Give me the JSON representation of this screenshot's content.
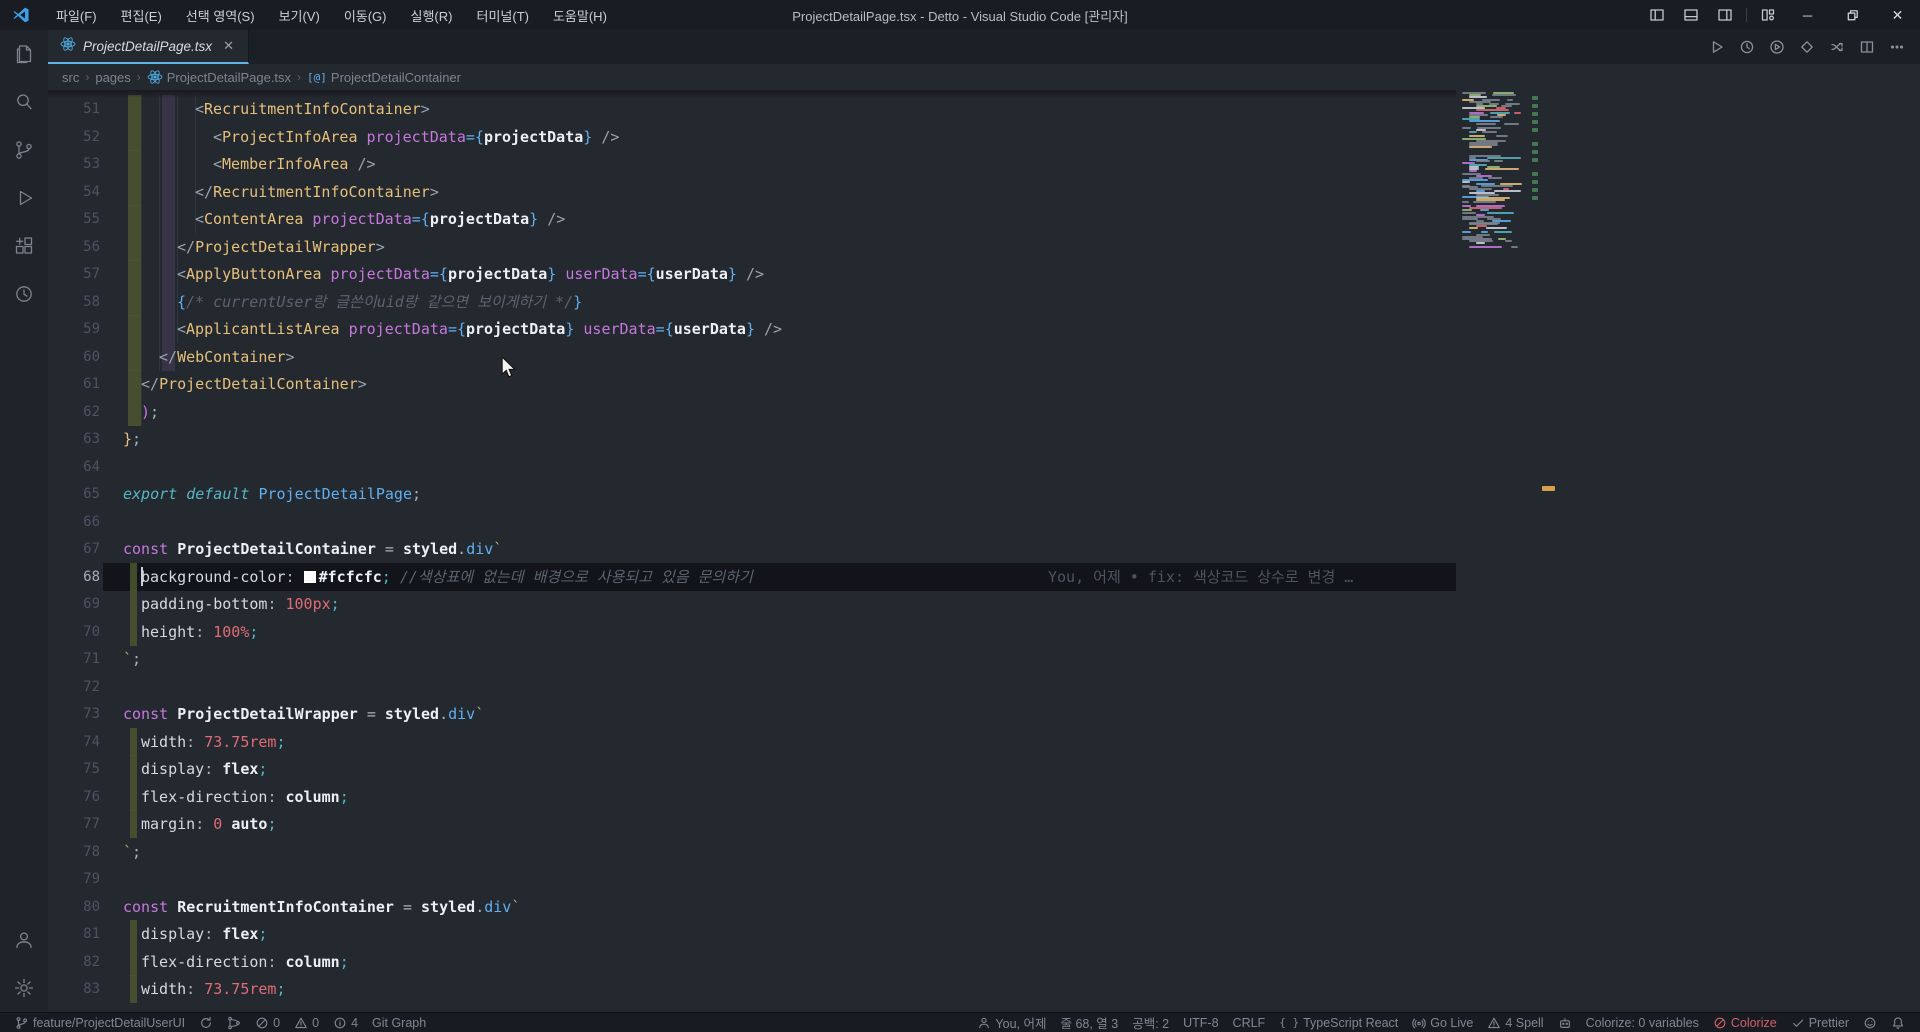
{
  "titlebar": {
    "title": "ProjectDetailPage.tsx - Detto - Visual Studio Code [관리자]",
    "menus": [
      "파일(F)",
      "편집(E)",
      "선택 영역(S)",
      "보기(V)",
      "이동(G)",
      "실행(R)",
      "터미널(T)",
      "도움말(H)"
    ],
    "layout_icons": [
      "layout-sidebar-left",
      "layout-panel-bottom",
      "layout-sidebar-right",
      "layout-customize"
    ],
    "window_controls": [
      "minimize",
      "restore",
      "close"
    ]
  },
  "activitybar": {
    "top": [
      "explorer",
      "search",
      "source-control",
      "run-debug",
      "extensions",
      "gitlens"
    ],
    "bottom": [
      "account",
      "settings"
    ]
  },
  "tab": {
    "label": "ProjectDetailPage.tsx"
  },
  "editor_actions": [
    "run",
    "history",
    "run-circle",
    "diamond",
    "swap",
    "split-editor",
    "more"
  ],
  "breadcrumb": {
    "items": [
      {
        "label": "src"
      },
      {
        "label": "pages"
      },
      {
        "icon": "react",
        "label": "ProjectDetailPage.tsx"
      },
      {
        "icon": "symbol",
        "label": "ProjectDetailContainer"
      }
    ]
  },
  "editor": {
    "cursor_line": 68,
    "cursor_col": 3,
    "blame": "You, 어제 • fix: 색상코드 상수로 변경 …",
    "lines": [
      {
        "n": 51,
        "i": 8,
        "g": 1,
        "t": [
          [
            "<",
            "br"
          ],
          [
            "RecruitmentInfoContainer",
            "tag"
          ],
          [
            ">",
            "br"
          ]
        ]
      },
      {
        "n": 52,
        "i": 10,
        "g": 1,
        "t": [
          [
            "<",
            "br"
          ],
          [
            "ProjectInfoArea",
            "tag"
          ],
          [
            " "
          ],
          [
            "projectData",
            "attr"
          ],
          [
            "=",
            "pb"
          ],
          [
            "{",
            "pb"
          ],
          [
            "projectData",
            "val"
          ],
          [
            "}",
            "pb"
          ],
          [
            " "
          ],
          [
            "/>",
            "br"
          ]
        ]
      },
      {
        "n": 53,
        "i": 10,
        "g": 1,
        "t": [
          [
            "<",
            "br"
          ],
          [
            "MemberInfoArea",
            "tag"
          ],
          [
            " "
          ],
          [
            "/>",
            "br"
          ]
        ]
      },
      {
        "n": 54,
        "i": 8,
        "g": 1,
        "t": [
          [
            "</",
            "br"
          ],
          [
            "RecruitmentInfoContainer",
            "tag"
          ],
          [
            ">",
            "br"
          ]
        ]
      },
      {
        "n": 55,
        "i": 8,
        "g": 1,
        "t": [
          [
            "<",
            "br"
          ],
          [
            "ContentArea",
            "tag"
          ],
          [
            " "
          ],
          [
            "projectData",
            "attr"
          ],
          [
            "=",
            "pb"
          ],
          [
            "{",
            "pb"
          ],
          [
            "projectData",
            "val"
          ],
          [
            "}",
            "pb"
          ],
          [
            " "
          ],
          [
            "/>",
            "br"
          ]
        ]
      },
      {
        "n": 56,
        "i": 6,
        "g": 1,
        "t": [
          [
            "</",
            "br"
          ],
          [
            "ProjectDetailWrapper",
            "tag"
          ],
          [
            ">",
            "br"
          ]
        ]
      },
      {
        "n": 57,
        "i": 6,
        "g": 1,
        "t": [
          [
            "<",
            "br"
          ],
          [
            "ApplyButtonArea",
            "tag"
          ],
          [
            " "
          ],
          [
            "projectData",
            "attr"
          ],
          [
            "=",
            "pb"
          ],
          [
            "{",
            "pb"
          ],
          [
            "projectData",
            "val"
          ],
          [
            "}",
            "pb"
          ],
          [
            " "
          ],
          [
            "userData",
            "attr"
          ],
          [
            "=",
            "pb"
          ],
          [
            "{",
            "pb"
          ],
          [
            "userData",
            "val"
          ],
          [
            "}",
            "pb"
          ],
          [
            " "
          ],
          [
            "/>",
            "br"
          ]
        ]
      },
      {
        "n": 58,
        "i": 6,
        "g": 1,
        "t": [
          [
            "{",
            "pb"
          ],
          [
            "/* currentUser랑 글쓴이uid랑 같으면 보이게하기 */",
            "cmt"
          ],
          [
            "}",
            "pb"
          ]
        ]
      },
      {
        "n": 59,
        "i": 6,
        "g": 1,
        "t": [
          [
            "<",
            "br"
          ],
          [
            "ApplicantListArea",
            "tag"
          ],
          [
            " "
          ],
          [
            "projectData",
            "attr"
          ],
          [
            "=",
            "pb"
          ],
          [
            "{",
            "pb"
          ],
          [
            "projectData",
            "val"
          ],
          [
            "}",
            "pb"
          ],
          [
            " "
          ],
          [
            "userData",
            "attr"
          ],
          [
            "=",
            "pb"
          ],
          [
            "{",
            "pb"
          ],
          [
            "userData",
            "val"
          ],
          [
            "}",
            "pb"
          ],
          [
            " "
          ],
          [
            "/>",
            "br"
          ]
        ]
      },
      {
        "n": 60,
        "i": 4,
        "g": 1,
        "t": [
          [
            "</",
            "br"
          ],
          [
            "WebContainer",
            "tag"
          ],
          [
            ">",
            "br"
          ]
        ]
      },
      {
        "n": 61,
        "i": 2,
        "g": 1,
        "t": [
          [
            "</",
            "br"
          ],
          [
            "ProjectDetailContainer",
            "tag"
          ],
          [
            ">",
            "br"
          ]
        ]
      },
      {
        "n": 62,
        "i": 2,
        "g": 1,
        "t": [
          [
            ")",
            "pk"
          ],
          [
            ";"
          ]
        ]
      },
      {
        "n": 63,
        "i": 0,
        "t": [
          [
            "}",
            "gold"
          ],
          [
            ";"
          ]
        ]
      },
      {
        "n": 64,
        "t": []
      },
      {
        "n": 65,
        "t": [
          [
            "export",
            "kw2"
          ],
          [
            " "
          ],
          [
            "default",
            "kw2"
          ],
          [
            " "
          ],
          [
            "ProjectDetailPage",
            "id"
          ],
          [
            ";"
          ]
        ]
      },
      {
        "n": 66,
        "t": []
      },
      {
        "n": 67,
        "t": [
          [
            "const",
            "kw"
          ],
          [
            " "
          ],
          [
            "ProjectDetailContainer",
            "val"
          ],
          [
            " = "
          ],
          [
            "styled",
            "val"
          ],
          [
            "."
          ],
          [
            "div",
            "id"
          ],
          [
            "`",
            "str"
          ]
        ]
      },
      {
        "n": 68,
        "i": 2,
        "g": 2,
        "c": 1,
        "b": 1,
        "t": [
          [
            "background-color",
            "prop"
          ],
          [
            ":"
          ],
          [
            " "
          ],
          [
            "",
            "swatch"
          ],
          [
            "#fcfcfc",
            "val"
          ],
          [
            ";",
            "semi"
          ],
          [
            " "
          ],
          [
            "//색상표에 없는데 배경으로 사용되고 있음 문의하기",
            "cmt"
          ]
        ]
      },
      {
        "n": 69,
        "i": 2,
        "g": 2,
        "t": [
          [
            "padding-bottom",
            "prop"
          ],
          [
            ":"
          ],
          [
            " "
          ],
          [
            "100px",
            "num"
          ],
          [
            ";",
            "semi"
          ]
        ]
      },
      {
        "n": 70,
        "i": 2,
        "g": 2,
        "t": [
          [
            "height",
            "prop"
          ],
          [
            ":"
          ],
          [
            " "
          ],
          [
            "100%",
            "num"
          ],
          [
            ";",
            "semi"
          ]
        ]
      },
      {
        "n": 71,
        "t": [
          [
            "`",
            "str"
          ],
          [
            ";"
          ]
        ]
      },
      {
        "n": 72,
        "t": []
      },
      {
        "n": 73,
        "t": [
          [
            "const",
            "kw"
          ],
          [
            " "
          ],
          [
            "ProjectDetailWrapper",
            "val"
          ],
          [
            " = "
          ],
          [
            "styled",
            "val"
          ],
          [
            "."
          ],
          [
            "div",
            "id"
          ],
          [
            "`",
            "str"
          ]
        ]
      },
      {
        "n": 74,
        "i": 2,
        "g": 2,
        "t": [
          [
            "width",
            "prop"
          ],
          [
            ":"
          ],
          [
            " "
          ],
          [
            "73.75rem",
            "num"
          ],
          [
            ";",
            "semi"
          ]
        ]
      },
      {
        "n": 75,
        "i": 2,
        "g": 2,
        "t": [
          [
            "display",
            "prop"
          ],
          [
            ":"
          ],
          [
            " "
          ],
          [
            "flex",
            "val"
          ],
          [
            ";",
            "semi"
          ]
        ]
      },
      {
        "n": 76,
        "i": 2,
        "g": 2,
        "t": [
          [
            "flex-direction",
            "prop"
          ],
          [
            ":"
          ],
          [
            " "
          ],
          [
            "column",
            "val"
          ],
          [
            ";",
            "semi"
          ]
        ]
      },
      {
        "n": 77,
        "i": 2,
        "g": 2,
        "t": [
          [
            "margin",
            "prop"
          ],
          [
            ":"
          ],
          [
            " "
          ],
          [
            "0",
            "num"
          ],
          [
            " "
          ],
          [
            "auto",
            "val"
          ],
          [
            ";",
            "semi"
          ]
        ]
      },
      {
        "n": 78,
        "t": [
          [
            "`",
            "str"
          ],
          [
            ";"
          ]
        ]
      },
      {
        "n": 79,
        "t": []
      },
      {
        "n": 80,
        "t": [
          [
            "const",
            "kw"
          ],
          [
            " "
          ],
          [
            "RecruitmentInfoContainer",
            "val"
          ],
          [
            " = "
          ],
          [
            "styled",
            "val"
          ],
          [
            "."
          ],
          [
            "div",
            "id"
          ],
          [
            "`",
            "str"
          ]
        ]
      },
      {
        "n": 81,
        "i": 2,
        "g": 2,
        "t": [
          [
            "display",
            "prop"
          ],
          [
            ":"
          ],
          [
            " "
          ],
          [
            "flex",
            "val"
          ],
          [
            ";",
            "semi"
          ]
        ]
      },
      {
        "n": 82,
        "i": 2,
        "g": 2,
        "t": [
          [
            "flex-direction",
            "prop"
          ],
          [
            ":"
          ],
          [
            " "
          ],
          [
            "column",
            "val"
          ],
          [
            ";",
            "semi"
          ]
        ]
      },
      {
        "n": 83,
        "i": 2,
        "g": 2,
        "t": [
          [
            "width",
            "prop"
          ],
          [
            ":"
          ],
          [
            " "
          ],
          [
            "73.75rem",
            "num"
          ],
          [
            ";",
            "semi"
          ]
        ]
      }
    ]
  },
  "statusbar": {
    "left": [
      {
        "icon": "branch",
        "label": "feature/ProjectDetailUserUI",
        "name": "git-branch"
      },
      {
        "icon": "sync",
        "label": "",
        "name": "sync"
      },
      {
        "icon": "graph",
        "label": "",
        "name": "git-graph-icon"
      },
      {
        "icon": "error",
        "label": "0",
        "name": "problems-errors"
      },
      {
        "icon": "warning",
        "label": "0",
        "name": "problems-warnings"
      },
      {
        "icon": "info",
        "label": "4",
        "name": "problems-info"
      },
      {
        "icon": "",
        "label": "Git Graph",
        "name": "git-graph"
      }
    ],
    "right": [
      {
        "icon": "person",
        "label": "You, 어제",
        "name": "gitlens-blame"
      },
      {
        "icon": "",
        "label": "줄 68, 열 3",
        "name": "cursor-position"
      },
      {
        "icon": "",
        "label": "공백: 2",
        "name": "indentation"
      },
      {
        "icon": "",
        "label": "UTF-8",
        "name": "encoding"
      },
      {
        "icon": "",
        "label": "CRLF",
        "name": "eol"
      },
      {
        "icon": "braces",
        "label": "TypeScript React",
        "name": "language-mode"
      },
      {
        "icon": "broadcast",
        "label": "Go Live",
        "name": "go-live"
      },
      {
        "icon": "warning",
        "label": "4 Spell",
        "name": "spell-checker"
      },
      {
        "icon": "robot",
        "label": "",
        "name": "robot"
      },
      {
        "icon": "",
        "label": "Colorize: 0 variables",
        "name": "colorize-count"
      },
      {
        "icon": "slash",
        "label": "Colorize",
        "accent": "#d2606a",
        "name": "colorize-toggle"
      },
      {
        "icon": "check",
        "label": "Prettier",
        "name": "prettier"
      },
      {
        "icon": "feedback",
        "label": "",
        "name": "feedback"
      },
      {
        "icon": "bell",
        "label": "",
        "name": "notifications"
      }
    ]
  },
  "colors": {
    "accent_blue": "#61afef",
    "tab_underline": "#5fb4e8",
    "tag_gold": "#e5c07b",
    "keyword_purple": "#c678dd",
    "number_red": "#e06c75",
    "string_green": "#98c379",
    "comment_gray": "#5c6370",
    "git_modified_bar": "#4d552f",
    "colorize_red": "#d2606a",
    "swatch": "#fcfcfc",
    "overview_current_mark": "#d7a04a"
  }
}
